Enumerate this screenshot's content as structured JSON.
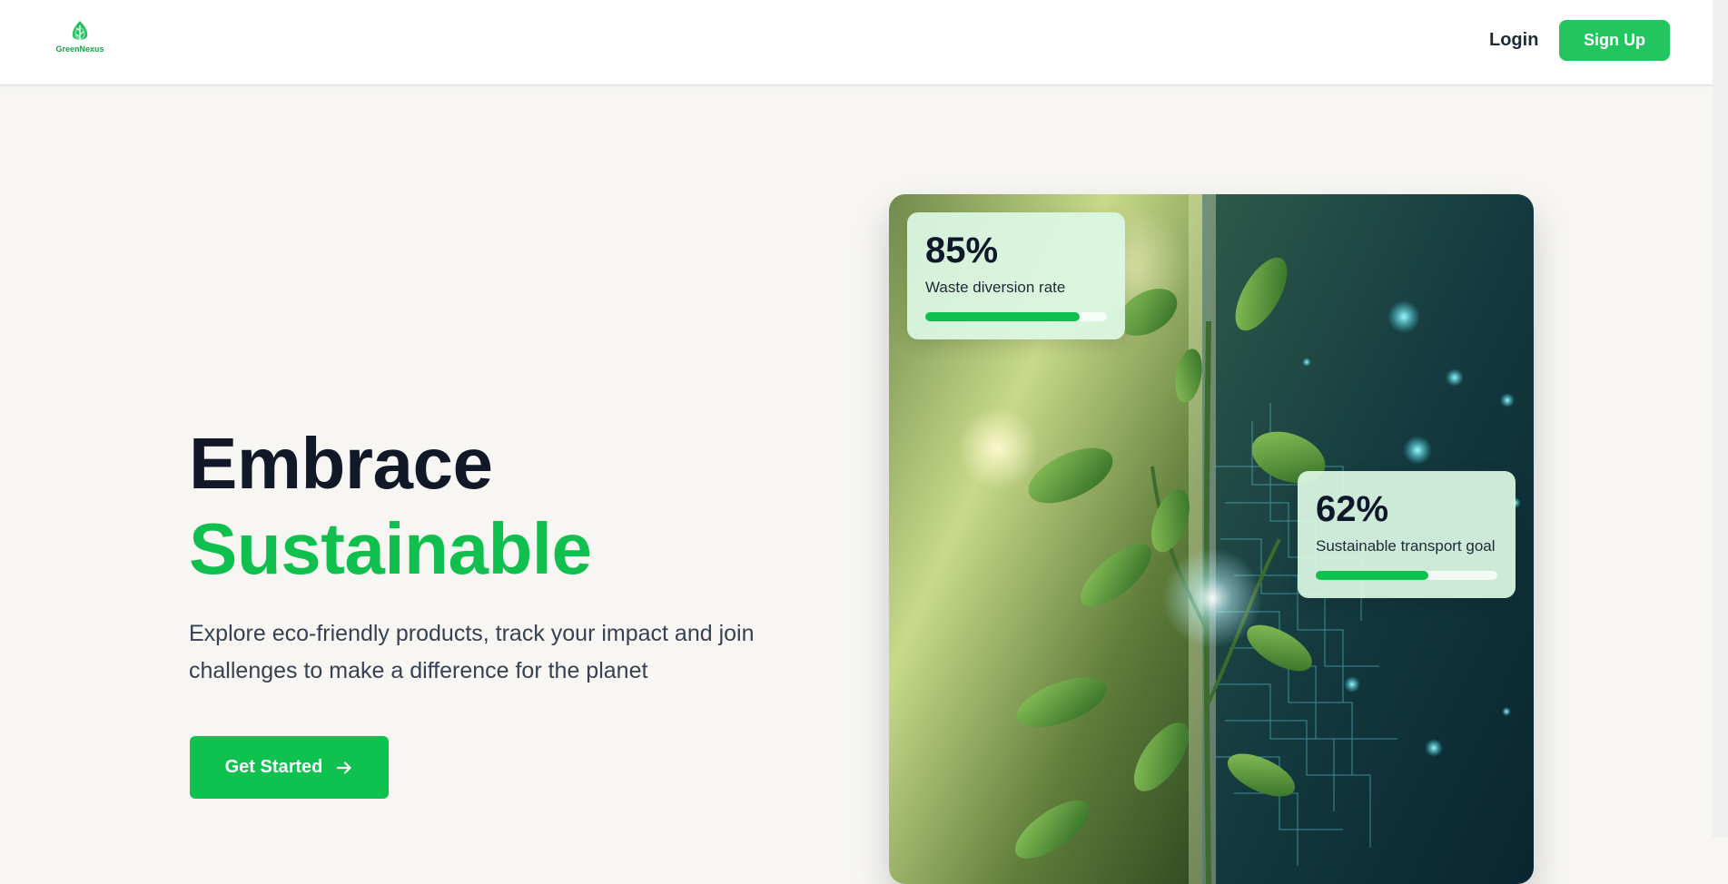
{
  "nav": {
    "logo_text": "GreenNexus",
    "login_label": "Login",
    "signup_label": "Sign Up"
  },
  "hero": {
    "headline_line1": "Embrace",
    "headline_line2": "Sustainable",
    "description": "Explore eco-friendly products, track your impact and join challenges to make a difference for the planet",
    "cta_label": "Get Started",
    "cta_icon": "arrow-right-icon"
  },
  "stats": [
    {
      "value": "85%",
      "label": "Waste diversion rate",
      "progress": 0.85
    },
    {
      "value": "62%",
      "label": "Sustainable transport goal",
      "progress": 0.62
    }
  ],
  "colors": {
    "brand_green": "#10c04e",
    "button_green": "#22c55e",
    "page_background": "#f7f6f3",
    "heading_dark": "#111827"
  }
}
